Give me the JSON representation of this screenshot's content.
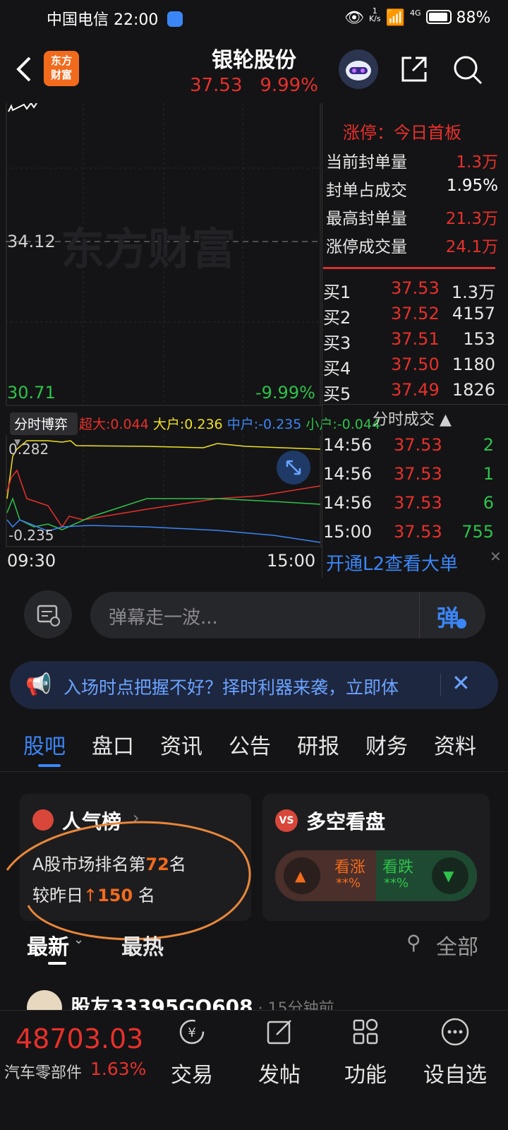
{
  "status": {
    "carrier": "中国电信",
    "time": "22:00",
    "speed": "1",
    "speed_unit": "K/s",
    "network": "4G",
    "battery": "88%"
  },
  "header": {
    "logo_text": "东方财富",
    "title": "银轮股份",
    "price": "37.53",
    "change_pct": "9.99%"
  },
  "chart": {
    "ref_price": "34.12",
    "low_price": "30.71",
    "low_pct": "-9.99%",
    "watermark": "东方财富",
    "indicator_label": "分时博弈",
    "legend": [
      {
        "label": "超大:0.044",
        "color": "#e8302a"
      },
      {
        "label": "大户:0.236",
        "color": "#f0e020"
      },
      {
        "label": "中户:-0.235",
        "color": "#3b86f6"
      },
      {
        "label": "小户:-0.044",
        "color": "#2ec24a"
      }
    ],
    "sub_max": "0.282",
    "sub_min": "-0.235",
    "time_start": "09:30",
    "time_end": "15:00"
  },
  "limit_panel": {
    "title_prefix": "涨停：",
    "title_value": "今日首板",
    "rows": [
      {
        "label": "当前封单量",
        "value": "1.3万",
        "color": "#e8302a"
      },
      {
        "label": "封单占成交",
        "value": "1.95%",
        "color": "#ffffff"
      },
      {
        "label": "最高封单量",
        "value": "21.3万",
        "color": "#e8302a"
      },
      {
        "label": "涨停成交量",
        "value": "24.1万",
        "color": "#e8302a"
      }
    ]
  },
  "order_book": [
    {
      "label": "买1",
      "price": "37.53",
      "qty": "1.3万"
    },
    {
      "label": "买2",
      "price": "37.52",
      "qty": "4157"
    },
    {
      "label": "买3",
      "price": "37.51",
      "qty": "153"
    },
    {
      "label": "买4",
      "price": "37.50",
      "qty": "1180"
    },
    {
      "label": "买5",
      "price": "37.49",
      "qty": "1826"
    }
  ],
  "trades": {
    "title": "分时成交 ▲",
    "rows": [
      {
        "time": "14:56",
        "price": "37.53",
        "vol": "2"
      },
      {
        "time": "14:56",
        "price": "37.53",
        "vol": "1"
      },
      {
        "time": "14:56",
        "price": "37.53",
        "vol": "6"
      },
      {
        "time": "15:00",
        "price": "37.53",
        "vol": "755"
      }
    ],
    "l2_promo": "开通L2查看大单"
  },
  "danmu": {
    "placeholder": "弹幕走一波...",
    "button": "弹"
  },
  "banner": {
    "text": "入场时点把握不好？择时利器来袭，立即体"
  },
  "tabs": [
    "股吧",
    "盘口",
    "资讯",
    "公告",
    "研报",
    "财务",
    "资料"
  ],
  "popularity": {
    "title": "人气榜",
    "rank_prefix": "A股市场排名第",
    "rank": "72",
    "rank_suffix": "名",
    "change_prefix": "较昨日",
    "change": "150",
    "change_suffix": "名"
  },
  "sentiment": {
    "title": "多空看盘",
    "bull_label": "看涨",
    "bull_value": "**%",
    "bear_label": "看跌",
    "bear_value": "**%"
  },
  "feed": {
    "sort_latest": "最新",
    "sort_hot": "最热",
    "filter": "全部",
    "first_user": "股友33395GQ608",
    "first_time": "15分钟前"
  },
  "bottom": {
    "index_value": "48703.03",
    "index_name": "汽车零部件",
    "index_pct": "1.63%",
    "nav": [
      "交易",
      "发帖",
      "功能",
      "设自选"
    ]
  }
}
